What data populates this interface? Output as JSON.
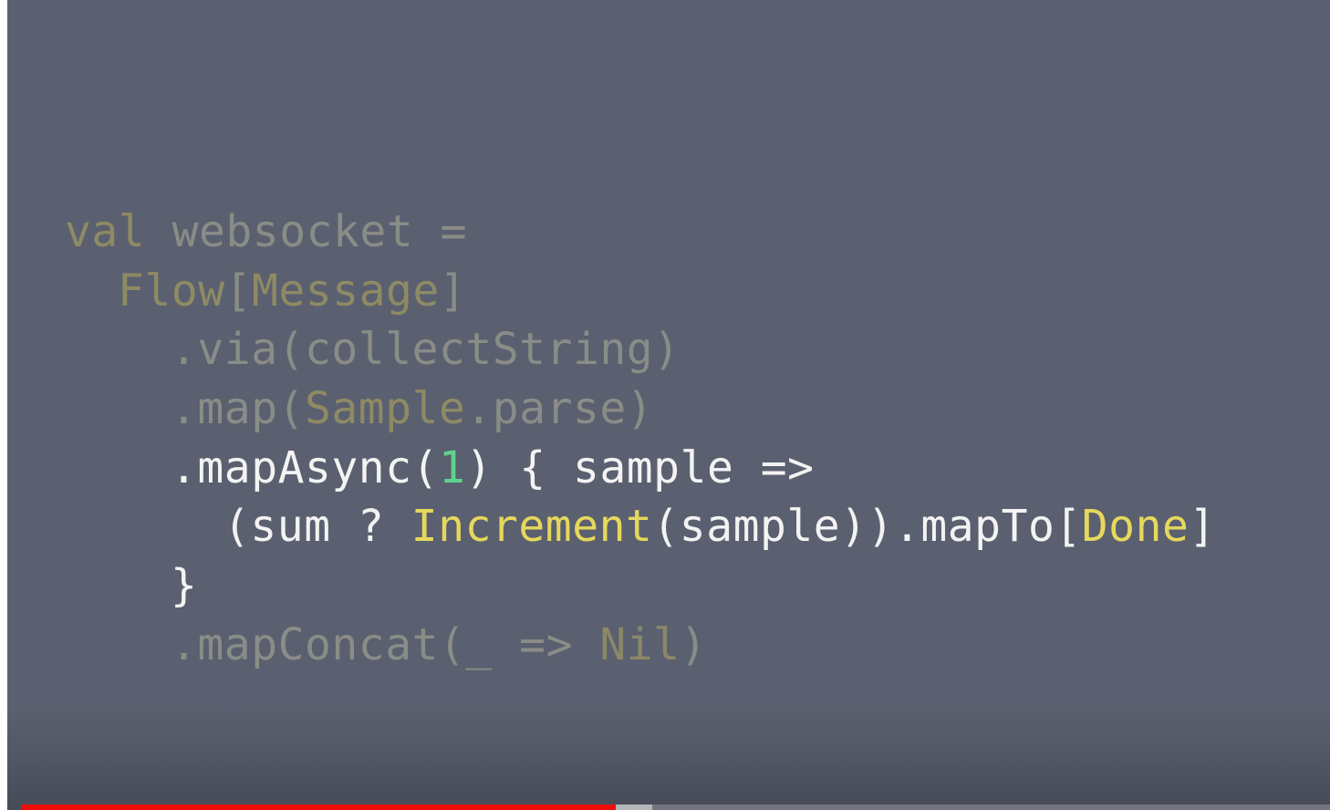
{
  "colors": {
    "background": "#5b6070",
    "dim_text": "#8a8c87",
    "dim_type": "#8e8a64",
    "bright_text": "#f3f3f3",
    "number": "#5fd38d",
    "type_highlight": "#e6d85c",
    "progress_played": "#f20d0d"
  },
  "code": {
    "line1": {
      "kw": "val",
      "rest": " websocket ="
    },
    "line2": {
      "type": "Flow",
      "open": "[",
      "type_param": "Message",
      "close": "]"
    },
    "line3": {
      "text": ".via(collectString)"
    },
    "line4": {
      "pre": ".map(",
      "type": "Sample",
      "post": ".parse)"
    },
    "line5": {
      "pre": ".mapAsync(",
      "num": "1",
      "post": ") { sample =>"
    },
    "line6": {
      "pre": "(sum ? ",
      "type1": "Increment",
      "mid": "(sample)).mapTo[",
      "type2": "Done",
      "post": "]"
    },
    "line7": {
      "text": "}"
    },
    "line8": {
      "pre": ".mapConcat(_ => ",
      "val": "Nil",
      "post": ")"
    }
  },
  "progress": {
    "played_fraction": 0.454,
    "buffered_fraction": 0.482
  }
}
